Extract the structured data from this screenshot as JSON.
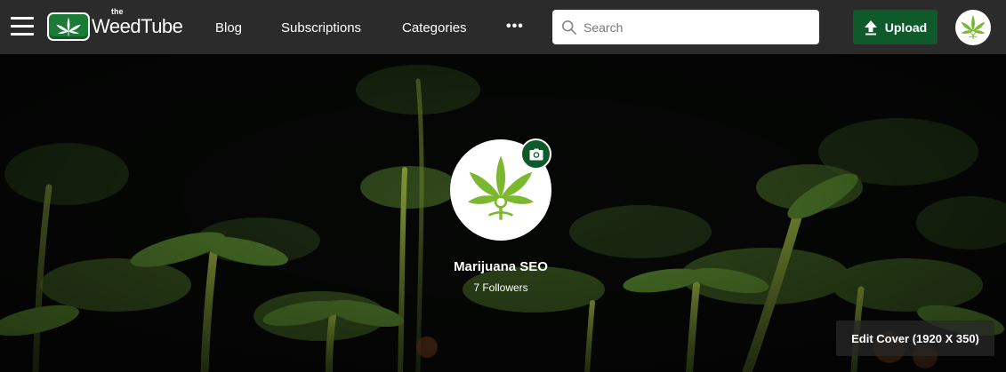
{
  "header": {
    "logo": {
      "small": "the",
      "name": "WeedTube"
    },
    "nav": {
      "blog": "Blog",
      "subscriptions": "Subscriptions",
      "categories": "Categories",
      "more": "•••"
    },
    "search": {
      "placeholder": "Search",
      "value": ""
    },
    "upload_label": "Upload"
  },
  "profile": {
    "channel_name": "Marijuana SEO",
    "followers_text": "7 Followers",
    "edit_cover_label": "Edit Cover (1920 X 350)"
  },
  "icons": {
    "menu": "hamburger-icon",
    "search": "search-icon",
    "upload": "upload-arrow-icon",
    "camera": "camera-icon",
    "leaf": "cannabis-leaf-icon"
  },
  "colors": {
    "header_bg": "#2b2b2b",
    "brand_green": "#0f5a2b",
    "leaf_green": "#7cb82f"
  }
}
